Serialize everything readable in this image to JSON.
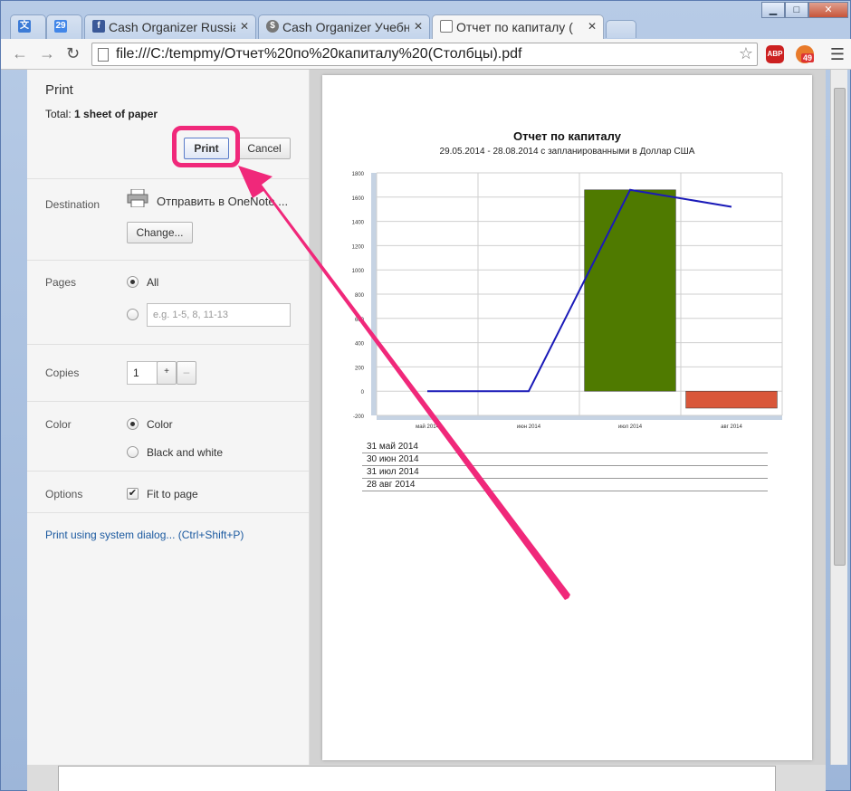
{
  "tabs": [
    {
      "label": "",
      "icon": "translate-app-icon",
      "color": "#3c7bd6"
    },
    {
      "label": "",
      "icon": "calendar-app-icon",
      "badge": "29",
      "color": "#4286e8"
    },
    {
      "label": "Cash Organizer Russia",
      "icon": "facebook-icon",
      "color": "#3b5998"
    },
    {
      "label": "Cash Organizer Учебн",
      "icon": "cash-organizer-icon",
      "color": "#777777"
    },
    {
      "label": "Отчет по капиталу (",
      "icon": "document-icon",
      "color": "#ffffff"
    }
  ],
  "address": {
    "url": "file:///C:/tempmy/Отчет%20по%20капиталу%20(Столбцы).pdf"
  },
  "extensions": {
    "abp": "ABP",
    "badge": "49"
  },
  "print": {
    "heading": "Print",
    "total_label": "Total:",
    "total_value": "1 sheet of paper",
    "print_button": "Print",
    "cancel_button": "Cancel",
    "destination_label": "Destination",
    "destination_value": "Отправить в OneNote ...",
    "change_button": "Change...",
    "pages_label": "Pages",
    "pages_all": "All",
    "pages_placeholder": "e.g. 1-5, 8, 11-13",
    "copies_label": "Copies",
    "copies_value": "1",
    "copies_plus": "+",
    "copies_minus": "–",
    "color_label": "Color",
    "color_option": "Color",
    "bw_option": "Black and white",
    "options_label": "Options",
    "fit_to_page": "Fit to page",
    "system_dialog": "Print using system dialog... (Ctrl+Shift+P)"
  },
  "report": {
    "title": "Отчет по капиталу",
    "subtitle": "29.05.2014 - 28.08.2014 с запланированными в Доллар США",
    "legend": [
      "31 май 2014",
      "30 июн 2014",
      "31 июл 2014",
      "28 авг 2014"
    ]
  },
  "chart_data": {
    "type": "bar",
    "title": "Отчет по капиталу",
    "subtitle": "29.05.2014 - 28.08.2014 с запланированными в Доллар США",
    "categories": [
      "май 2014",
      "июн 2014",
      "июл 2014",
      "авг 2014"
    ],
    "ylim": [
      -200,
      1800
    ],
    "yticks": [
      -200,
      0,
      200,
      400,
      600,
      800,
      1000,
      1200,
      1400,
      1600,
      1800
    ],
    "series": [
      {
        "type": "bar",
        "values": [
          0,
          0,
          1660,
          -140
        ],
        "colors": [
          "#4f7a00",
          "#4f7a00",
          "#4f7a00",
          "#d9573a"
        ]
      },
      {
        "type": "line",
        "values": [
          0,
          0,
          1660,
          1520
        ],
        "color": "#1a1ab8"
      }
    ],
    "grid": true
  },
  "colors": {
    "highlight": "#f0287a"
  }
}
